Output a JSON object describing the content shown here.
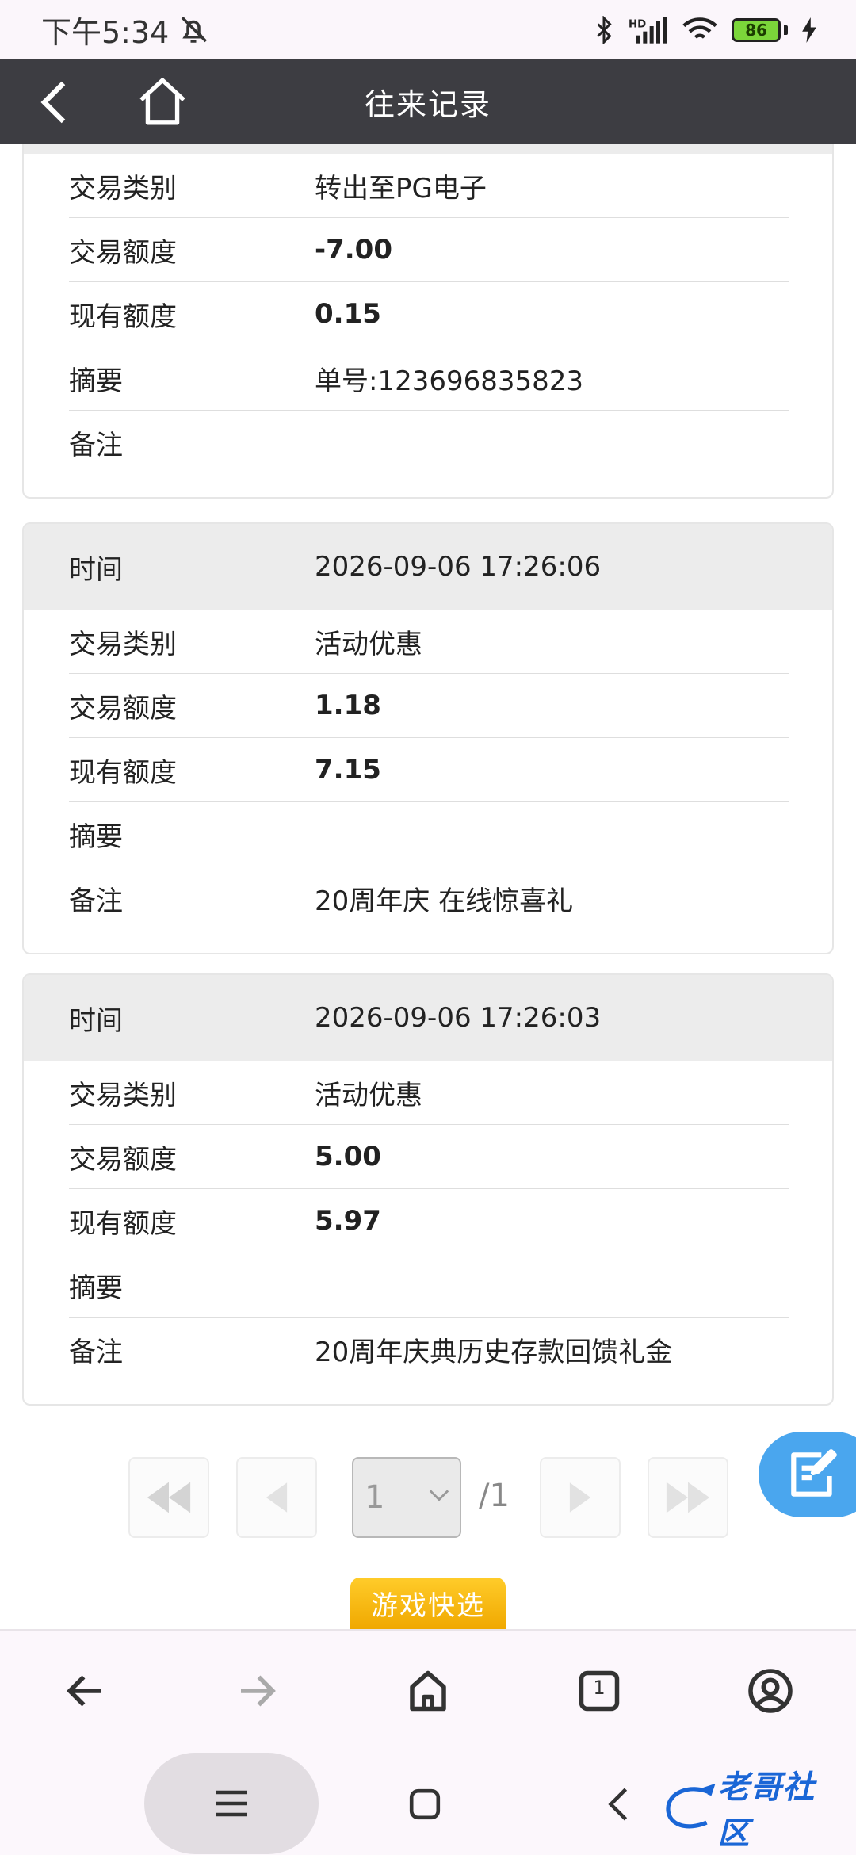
{
  "status": {
    "time": "下午5:34",
    "battery": "86"
  },
  "header": {
    "title": "往来记录"
  },
  "cards": [
    {
      "time_label": "",
      "time_value": "",
      "rows": [
        {
          "label": "交易类别",
          "value": "转出至PG电子"
        },
        {
          "label": "交易额度",
          "value": "-7.00"
        },
        {
          "label": "现有额度",
          "value": "0.15"
        },
        {
          "label": "摘要",
          "value": "单号:123696835823"
        },
        {
          "label": "备注",
          "value": ""
        }
      ]
    },
    {
      "time_label": "时间",
      "time_value": "2026-09-06 17:26:06",
      "rows": [
        {
          "label": "交易类别",
          "value": "活动优惠"
        },
        {
          "label": "交易额度",
          "value": "1.18"
        },
        {
          "label": "现有额度",
          "value": "7.15"
        },
        {
          "label": "摘要",
          "value": ""
        },
        {
          "label": "备注",
          "value": "20周年庆 在线惊喜礼"
        }
      ]
    },
    {
      "time_label": "时间",
      "time_value": "2026-09-06 17:26:03",
      "rows": [
        {
          "label": "交易类别",
          "value": "活动优惠"
        },
        {
          "label": "交易额度",
          "value": "5.00"
        },
        {
          "label": "现有额度",
          "value": "5.97"
        },
        {
          "label": "摘要",
          "value": ""
        },
        {
          "label": "备注",
          "value": "20周年庆典历史存款回馈礼金"
        }
      ]
    }
  ],
  "pagination": {
    "current": "1",
    "total": "/1"
  },
  "quick_select": {
    "label": "游戏快选"
  },
  "browser": {
    "tab_count": "1"
  },
  "watermark": {
    "text": "老哥社区"
  },
  "colors": {
    "header_bg": "#3d3d42",
    "fab_bg": "#4aa6ee",
    "quick_btn": "#f5b400"
  }
}
